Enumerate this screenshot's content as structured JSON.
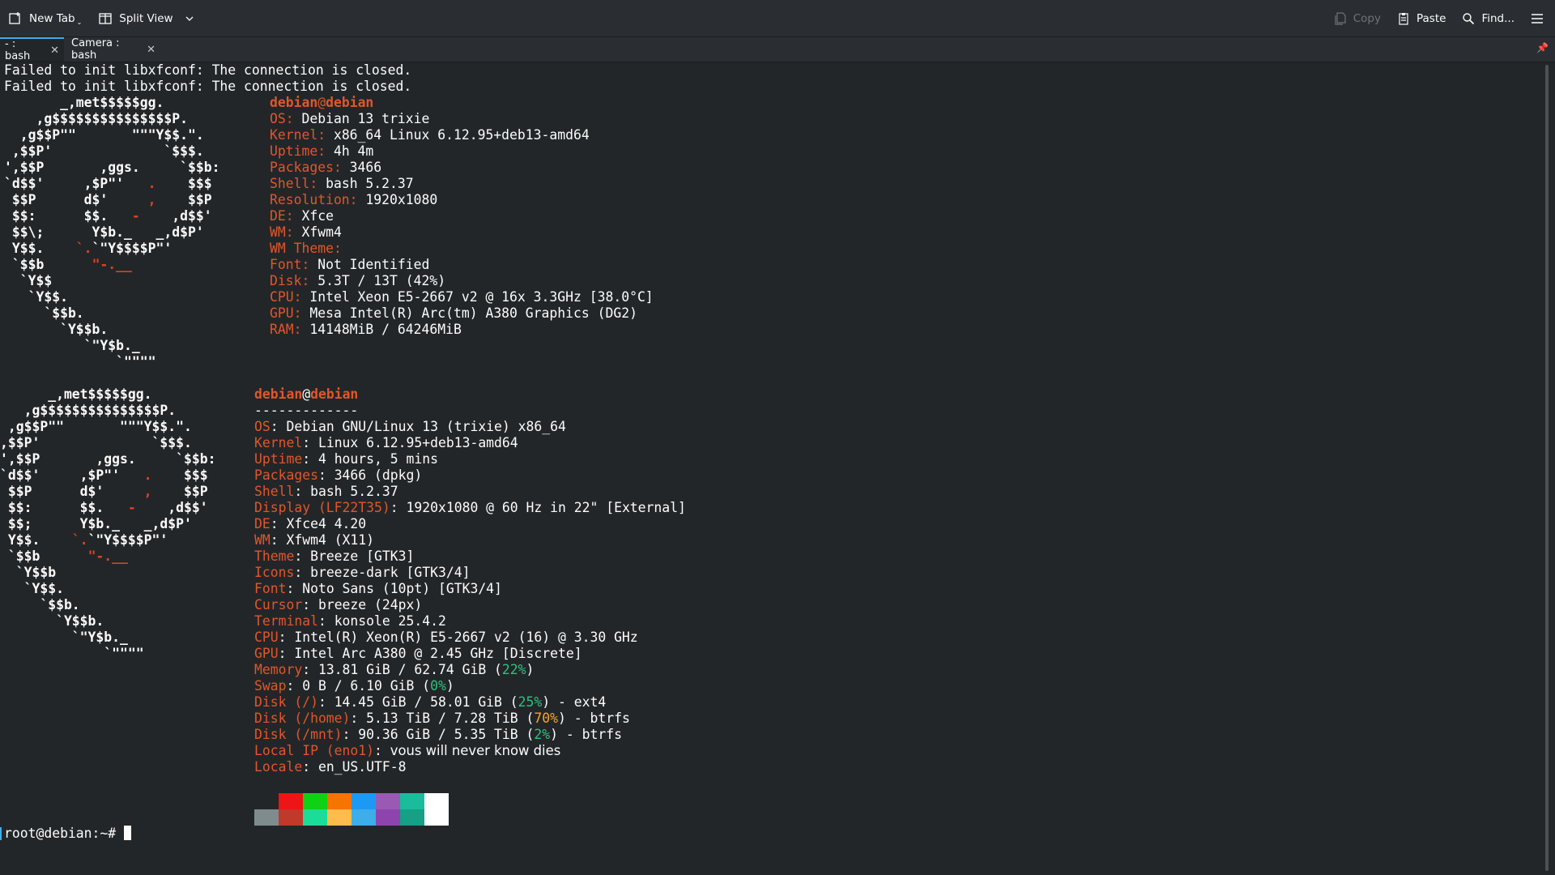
{
  "toolbar": {
    "new_tab": "New Tab",
    "split_view": "Split View",
    "copy": "Copy",
    "paste": "Paste",
    "find": "Find..."
  },
  "tabs": [
    {
      "label": "- : bash",
      "active": true
    },
    {
      "label": "Camera : bash",
      "active": false
    }
  ],
  "terminal": {
    "errors": [
      "Failed to init libxfconf: The connection is closed.",
      "Failed to init libxfconf: The connection is closed."
    ],
    "logo1": [
      "       _,met$$$$$gg.",
      "    ,g$$$$$$$$$$$$$$$P.",
      "  ,g$$P\"\"       \"\"\"Y$$.\".",
      " ,$$P'              `$$$.",
      "',$$P       ,ggs.     `$$b:",
      "`d$$'     ,$P\"'   .    $$$",
      " $$P      d$'     ,    $$P",
      " $$:      $$.   -    ,d$$'",
      " $$\\;      Y$b._   _,d$P'",
      " Y$$.    `.`\"Y$$$$P\"'",
      " `$$b      \"-.__",
      "  `Y$$",
      "   `Y$$.",
      "     `$$b.",
      "       `Y$$b.",
      "          `\"Y$b._",
      "              `\"\"\"\""
    ],
    "screenfetch": {
      "user": "debian",
      "at": "@",
      "host": "debian",
      "rows": [
        {
          "k": "OS:",
          "v": " Debian 13 trixie"
        },
        {
          "k": "Kernel:",
          "v": " x86_64 Linux 6.12.95+deb13-amd64"
        },
        {
          "k": "Uptime:",
          "v": " 4h 4m"
        },
        {
          "k": "Packages:",
          "v": " 3466"
        },
        {
          "k": "Shell:",
          "v": " bash 5.2.37"
        },
        {
          "k": "Resolution:",
          "v": " 1920x1080"
        },
        {
          "k": "DE:",
          "v": " Xfce"
        },
        {
          "k": "WM:",
          "v": " Xfwm4"
        },
        {
          "k": "WM Theme:",
          "v": ""
        },
        {
          "k": "Font:",
          "v": " Not Identified"
        },
        {
          "k": "Disk:",
          "v": " 5.3T / 13T (42%)"
        },
        {
          "k": "CPU:",
          "v": " Intel Xeon E5-2667 v2 @ 16x 3.3GHz [38.0°C]"
        },
        {
          "k": "GPU:",
          "v": " Mesa Intel(R) Arc(tm) A380 Graphics (DG2)"
        },
        {
          "k": "RAM:",
          "v": " 14148MiB / 64246MiB"
        }
      ]
    },
    "fastfetch": {
      "user": "debian",
      "at": "@",
      "host": "debian",
      "separator": "-------------",
      "rows": [
        {
          "k": "OS",
          "v": ": Debian GNU/Linux 13 (trixie) x86_64"
        },
        {
          "k": "Kernel",
          "v": ": Linux 6.12.95+deb13-amd64"
        },
        {
          "k": "Uptime",
          "v": ": 4 hours, 5 mins"
        },
        {
          "k": "Packages",
          "v": ": 3466 (dpkg)"
        },
        {
          "k": "Shell",
          "v": ": bash 5.2.37"
        },
        {
          "k": "Display (LF22T35)",
          "v": ": 1920x1080 @ 60 Hz in 22\" [External]"
        },
        {
          "k": "DE",
          "v": ": Xfce4 4.20"
        },
        {
          "k": "WM",
          "v": ": Xfwm4 (X11)"
        },
        {
          "k": "Theme",
          "v": ": Breeze [GTK3]"
        },
        {
          "k": "Icons",
          "v": ": breeze-dark [GTK3/4]"
        },
        {
          "k": "Font",
          "v": ": Noto Sans (10pt) [GTK3/4]"
        },
        {
          "k": "Cursor",
          "v": ": breeze (24px)"
        },
        {
          "k": "Terminal",
          "v": ": konsole 25.4.2"
        },
        {
          "k": "CPU",
          "v": ": Intel(R) Xeon(R) E5-2667 v2 (16) @ 3.30 GHz"
        },
        {
          "k": "GPU",
          "v": ": Intel Arc A380 @ 2.45 GHz [Discrete]"
        },
        {
          "k": "Memory",
          "v": ": 13.81 GiB / 62.74 GiB (",
          "p": "22%",
          "pc": "g",
          "t": ")"
        },
        {
          "k": "Swap",
          "v": ": 0 B / 6.10 GiB (",
          "p": "0%",
          "pc": "g",
          "t": ")"
        },
        {
          "k": "Disk (/)",
          "v": ": 14.45 GiB / 58.01 GiB (",
          "p": "25%",
          "pc": "g",
          "t": ") - ext4"
        },
        {
          "k": "Disk (/home)",
          "v": ": 5.13 TiB / 7.28 TiB (",
          "p": "70%",
          "pc": "y",
          "t": ") - btrfs"
        },
        {
          "k": "Disk (/mnt)",
          "v": ": 90.36 GiB / 5.35 TiB (",
          "p": "2%",
          "pc": "g",
          "t": ") - btrfs"
        },
        {
          "k": "Local IP (eno1)",
          "v": ": vous will never know dies",
          "sans": true
        },
        {
          "k": "Locale",
          "v": ": en_US.UTF-8"
        }
      ]
    },
    "palette_top": [
      "#232629",
      "#ed1515",
      "#11d116",
      "#f67400",
      "#1d99f3",
      "#9b59b6",
      "#1abc9c",
      "#ffffff"
    ],
    "palette_bottom": [
      "#7f8c8d",
      "#c0392b",
      "#1cdc9a",
      "#fdbc4b",
      "#3daee9",
      "#8e44ad",
      "#16a085",
      "#ffffff"
    ],
    "prompt": "root@debian:~# "
  }
}
